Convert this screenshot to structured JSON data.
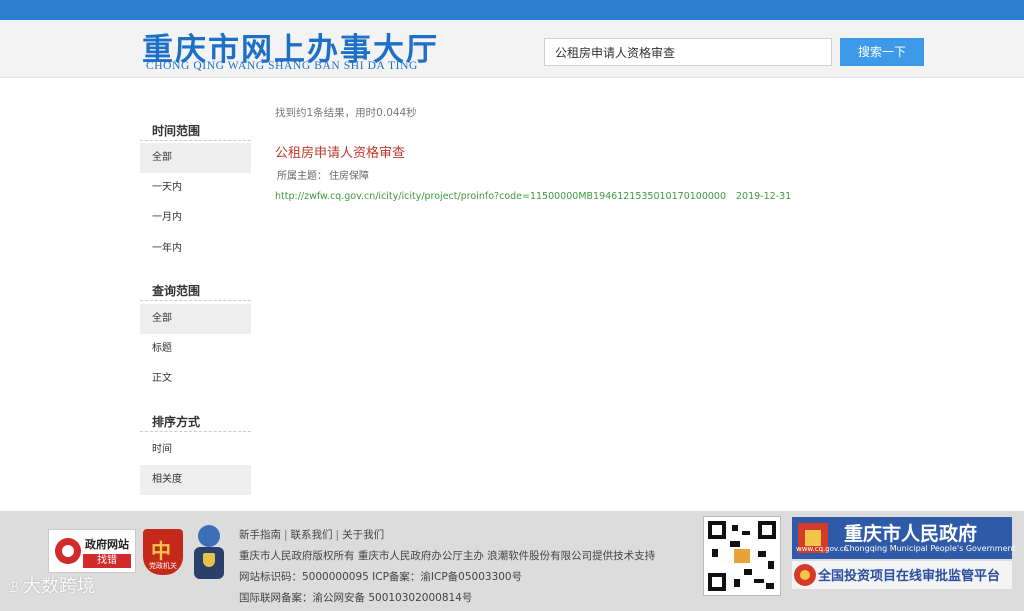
{
  "colors": {
    "topbar": "#2c7ed1",
    "brand_blue": "#1e6fc8",
    "search_button": "#3d9ae8",
    "result_title": "#c0392b",
    "result_url": "#3f9a3f"
  },
  "header": {
    "logo_cn": "重庆市网上办事大厅",
    "logo_en": "CHONG QING WANG SHANG BAN SHI DA TING",
    "search_value": "公租房申请人资格审查",
    "search_button": "搜索一下"
  },
  "sidebar": {
    "time_range": {
      "title": "时间范围",
      "items": [
        "全部",
        "一天内",
        "一月内",
        "一年内"
      ],
      "selected": "全部"
    },
    "query_range": {
      "title": "查询范围",
      "items": [
        "全部",
        "标题",
        "正文"
      ],
      "selected": "全部"
    },
    "sort": {
      "title": "排序方式",
      "items": [
        "时间",
        "相关度"
      ],
      "selected": "相关度"
    }
  },
  "results": {
    "summary": "找到约1条结果，用时0.044秒",
    "items": [
      {
        "title": "公租房申请人资格审查",
        "topic_label": "所属主题：",
        "topic": "住房保障",
        "url": "http://zwfw.cq.gov.cn/icity/icity/project/proinfo?code=11500000MB1946121535010170100000",
        "date": "2019-12-31"
      }
    ]
  },
  "footer": {
    "badges": {
      "zhaocuo_title": "政府网站",
      "zhaocuo_sub": "找错",
      "dangzheng_char": "中",
      "dangzheng_sub": "党政机关"
    },
    "links": [
      "新手指南",
      "联系我们",
      "关于我们"
    ],
    "copyright": "重庆市人民政府版权所有 重庆市人民政府办公厅主办 浪潮软件股份有限公司提供技术支持",
    "site_id": "网站标识码：5000000095 ICP备案：渝ICP备05003300号",
    "police": "国际联网备案：渝公网安备 50010302000814号",
    "gov_banner_cn": "重庆市人民政府",
    "gov_banner_en": "Chongqing Municipal People's Government",
    "gov_banner_site": "www.cq.gov.cn",
    "invest_banner": "全国投资项目在线审批监管平台"
  },
  "watermark": {
    "icon": "ℬ",
    "text": "大数跨境"
  }
}
